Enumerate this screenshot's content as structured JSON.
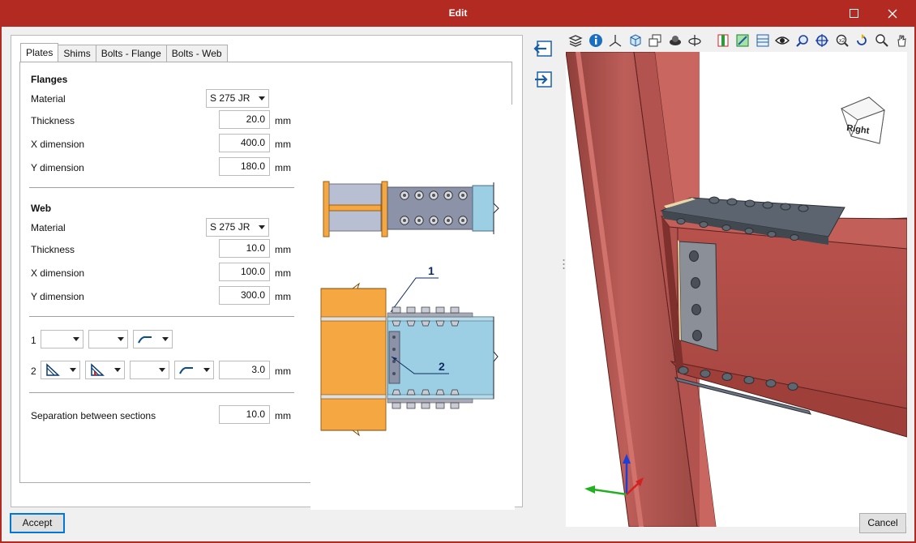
{
  "window": {
    "title": "Edit"
  },
  "tabs": [
    "Plates",
    "Shims",
    "Bolts - Flange",
    "Bolts - Web"
  ],
  "flanges": {
    "heading": "Flanges",
    "material_label": "Material",
    "material_value": "S 275 JR",
    "thickness_label": "Thickness",
    "thickness_value": "20.0",
    "x_label": "X dimension",
    "x_value": "400.0",
    "y_label": "Y dimension",
    "y_value": "180.0",
    "unit": "mm"
  },
  "web": {
    "heading": "Web",
    "material_label": "Material",
    "material_value": "S 275 JR",
    "thickness_label": "Thickness",
    "thickness_value": "10.0",
    "x_label": "X dimension",
    "x_value": "100.0",
    "y_label": "Y dimension",
    "y_value": "300.0",
    "unit": "mm"
  },
  "welds": {
    "row1_label": "1",
    "row2_label": "2",
    "row2_value": "3.0",
    "unit": "mm"
  },
  "separation": {
    "label": "Separation between sections",
    "value": "10.0",
    "unit": "mm"
  },
  "preview": {
    "callout1": "1",
    "callout2": "2"
  },
  "viewcube": {
    "face_label": "Right"
  },
  "buttons": {
    "accept": "Accept",
    "cancel": "Cancel"
  },
  "colors": {
    "titlebar": "#b22a22",
    "steel": "#b45a56",
    "plate": "#f5a742",
    "section_blue": "#9ccfe4",
    "accent": "#0078d7"
  },
  "toolbar_icons": [
    "layers-icon",
    "info-icon",
    "axes-icon",
    "cube-view-icon",
    "multi-view-icon",
    "render-icon",
    "orbit-icon",
    "section-box-icon",
    "section-plane-icon",
    "grid-icon",
    "visibility-eye-icon",
    "zoom-previous-icon",
    "zoom-extents-icon",
    "zoom-window-icon",
    "rotate-icon",
    "zoom-icon",
    "pan-hand-icon"
  ]
}
